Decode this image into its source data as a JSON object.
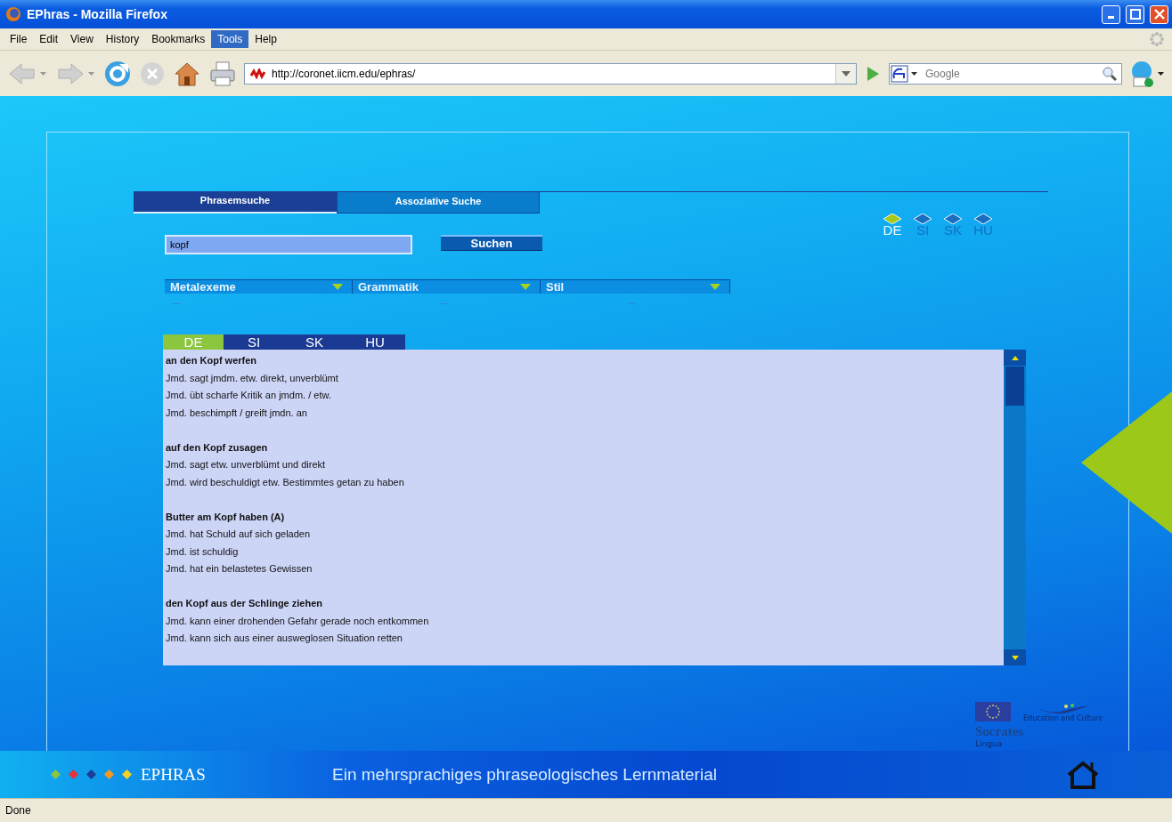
{
  "window": {
    "title": "EPhras - Mozilla Firefox"
  },
  "menu": [
    {
      "label": "File",
      "selected": false
    },
    {
      "label": "Edit",
      "selected": false
    },
    {
      "label": "View",
      "selected": false
    },
    {
      "label": "History",
      "selected": false
    },
    {
      "label": "Bookmarks",
      "selected": false
    },
    {
      "label": "Tools",
      "selected": true
    },
    {
      "label": "Help",
      "selected": false
    }
  ],
  "address": {
    "url": "http://coronet.iicm.edu/ephras/"
  },
  "search": {
    "placeholder": "Google"
  },
  "tabs": [
    {
      "label": "Phrasemsuche",
      "selected": true
    },
    {
      "label": "Assoziative Suche",
      "selected": false
    }
  ],
  "query": {
    "value": "kopf"
  },
  "search_button": "Suchen",
  "languages": [
    {
      "label": "DE",
      "selected": true
    },
    {
      "label": "SI",
      "selected": false
    },
    {
      "label": "SK",
      "selected": false
    },
    {
      "label": "HU",
      "selected": false
    }
  ],
  "filters": [
    {
      "label": "Metalexeme",
      "value": "---"
    },
    {
      "label": "Grammatik",
      "value": "---"
    },
    {
      "label": "Stil",
      "value": "---"
    }
  ],
  "result_tabs": [
    {
      "label": "DE",
      "selected": true
    },
    {
      "label": "SI",
      "selected": false
    },
    {
      "label": "SK",
      "selected": false
    },
    {
      "label": "HU",
      "selected": false
    }
  ],
  "entries": [
    {
      "heading": "an den Kopf werfen",
      "lines": [
        "Jmd. sagt jmdm. etw. direkt, unverblümt",
        "Jmd. übt scharfe Kritik an jmdm. / etw.",
        "Jmd. beschimpft / greift jmdn. an"
      ]
    },
    {
      "heading": "auf den Kopf zusagen",
      "lines": [
        "Jmd. sagt etw. unverblümt und direkt",
        "Jmd. wird beschuldigt etw. Bestimmtes getan zu haben"
      ]
    },
    {
      "heading": "Butter am Kopf haben (A)",
      "lines": [
        "Jmd. hat Schuld auf sich geladen",
        "Jmd. ist schuldig",
        "Jmd. hat ein belastetes Gewissen"
      ]
    },
    {
      "heading": "den Kopf aus der Schlinge ziehen",
      "lines": [
        "Jmd. kann einer drohenden Gefahr gerade noch entkommen",
        "Jmd. kann sich aus einer ausweglosen Situation retten"
      ]
    }
  ],
  "sponsor": {
    "program": "Education and Culture",
    "name": "Socrates",
    "subtitle": "Lingua"
  },
  "footer": {
    "diamonds": [
      {
        "color": "#8cc63f"
      },
      {
        "color": "#e8323c"
      },
      {
        "color": "#1e3c96"
      },
      {
        "color": "#f39a1e"
      },
      {
        "color": "#f5d21e"
      }
    ],
    "brand": "EPHRAS",
    "tagline": "Ein mehrsprachiges phraseologisches Lernmaterial"
  },
  "status_bar": "Done"
}
